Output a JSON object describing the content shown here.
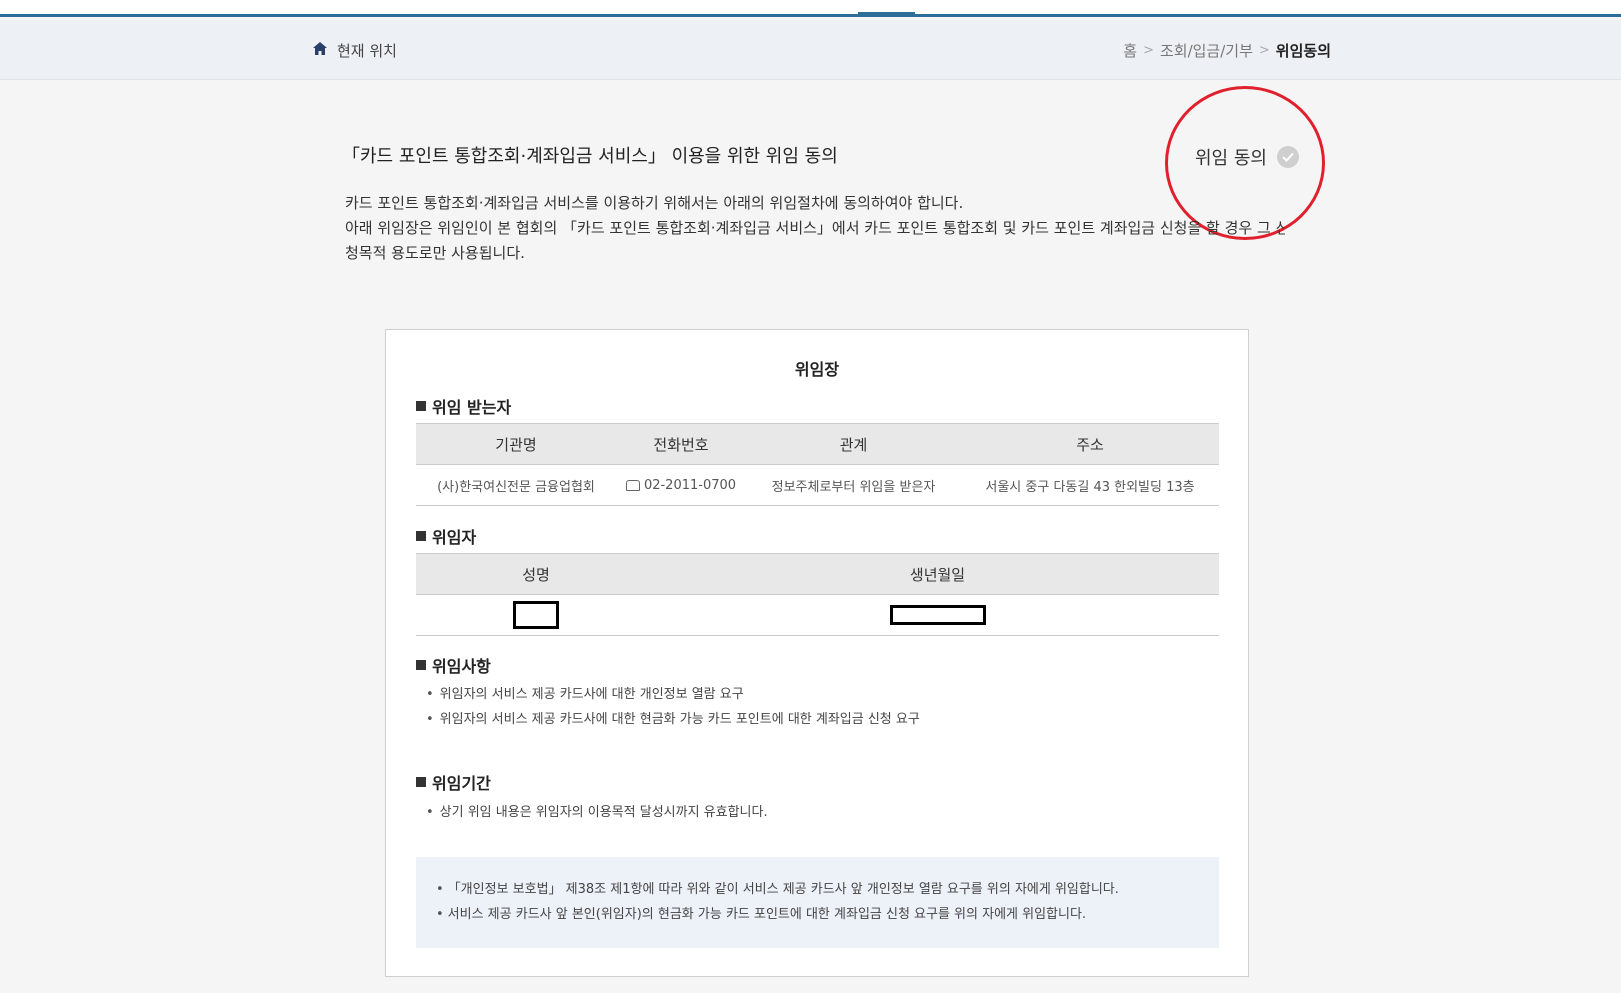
{
  "location": {
    "label": "현재 위치",
    "breadcrumb": [
      "홈",
      "조회/입금/기부",
      "위임동의"
    ],
    "separator": ">"
  },
  "page": {
    "title": "「카드 포인트 통합조회·계좌입금 서비스」 이용을 위한 위임 동의",
    "consent_status_label": "위임 동의",
    "intro_lines": [
      "카드 포인트 통합조회·계좌입금 서비스를 이용하기 위해서는 아래의 위임절차에 동의하여야 합니다.",
      "아래 위임장은 위임인이 본 협회의 「카드 포인트 통합조회·계좌입금 서비스」에서 카드 포인트 통합조회 및 카드 포인트 계좌입금 신청을 할 경우 그 신",
      "청목적 용도로만 사용됩니다."
    ]
  },
  "document": {
    "title": "위임장",
    "recipient": {
      "heading": "위임 받는자",
      "columns": [
        "기관명",
        "전화번호",
        "관계",
        "주소"
      ],
      "row": [
        "(사)한국여신전문 금융업협회",
        "02-2011-0700",
        "정보주체로부터 위임을 받은자",
        "서울시 중구 다동길 43 한외빌딩 13층"
      ]
    },
    "delegator": {
      "heading": "위임자",
      "columns": [
        "성명",
        "생년월일"
      ]
    },
    "matters": {
      "heading": "위임사항",
      "items": [
        "위임자의 서비스 제공 카드사에 대한 개인정보 열람 요구",
        "위임자의 서비스 제공 카드사에 대한 현금화 가능 카드 포인트에 대한 계좌입금 신청 요구"
      ]
    },
    "period": {
      "heading": "위임기간",
      "items": [
        "상기 위임 내용은 위임자의 이용목적 달성시까지 유효합니다."
      ]
    },
    "notice": [
      "「개인정보 보호법」 제38조 제1항에 따라 위와 같이 서비스 제공 카드사 앞 개인정보 열람 요구를 위의 자에게 위임합니다.",
      "서비스 제공 카드사 앞 본인(위임자)의 현금화 가능 카드 포인트에 대한 계좌입금 신청 요구를 위의 자에게 위임합니다."
    ]
  },
  "colors": {
    "accent": "#2c6e97",
    "annotation_circle": "#e0212d"
  }
}
